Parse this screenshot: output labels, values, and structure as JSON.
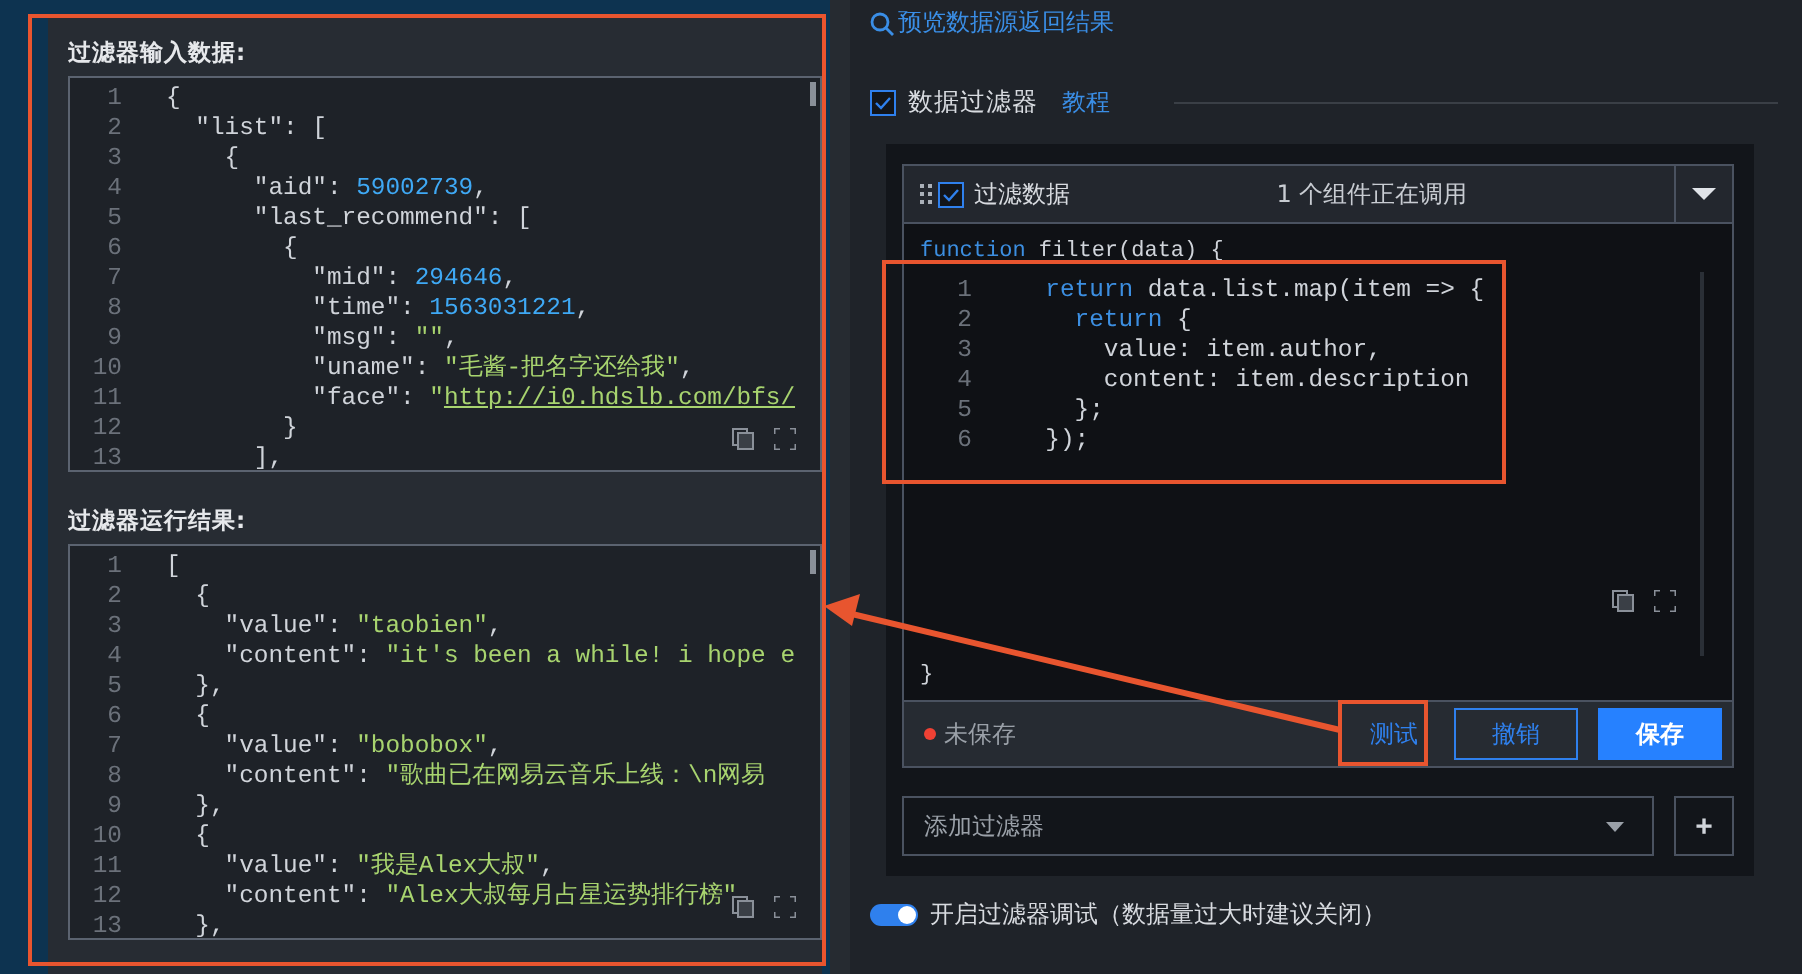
{
  "input_panel": {
    "title": "过滤器输入数据:",
    "lines": [
      {
        "n": "1",
        "segs": [
          {
            "t": "{",
            "kind": "plain"
          }
        ]
      },
      {
        "n": "2",
        "segs": [
          {
            "t": "  \"list\": [",
            "kind": "plain"
          }
        ]
      },
      {
        "n": "3",
        "segs": [
          {
            "t": "    {",
            "kind": "plain"
          }
        ]
      },
      {
        "n": "4",
        "segs": [
          {
            "t": "      \"aid\": ",
            "kind": "plain"
          },
          {
            "t": "59002739",
            "kind": "number"
          },
          {
            "t": ",",
            "kind": "plain"
          }
        ]
      },
      {
        "n": "5",
        "segs": [
          {
            "t": "      \"last_recommend\": [",
            "kind": "plain"
          }
        ]
      },
      {
        "n": "6",
        "segs": [
          {
            "t": "        {",
            "kind": "plain"
          }
        ]
      },
      {
        "n": "7",
        "segs": [
          {
            "t": "          \"mid\": ",
            "kind": "plain"
          },
          {
            "t": "294646",
            "kind": "number"
          },
          {
            "t": ",",
            "kind": "plain"
          }
        ]
      },
      {
        "n": "8",
        "segs": [
          {
            "t": "          \"time\": ",
            "kind": "plain"
          },
          {
            "t": "1563031221",
            "kind": "number"
          },
          {
            "t": ",",
            "kind": "plain"
          }
        ]
      },
      {
        "n": "9",
        "segs": [
          {
            "t": "          \"msg\": ",
            "kind": "plain"
          },
          {
            "t": "\"\"",
            "kind": "string"
          },
          {
            "t": ",",
            "kind": "plain"
          }
        ]
      },
      {
        "n": "10",
        "segs": [
          {
            "t": "          \"uname\": ",
            "kind": "plain"
          },
          {
            "t": "\"毛酱-把名字还给我\"",
            "kind": "string"
          },
          {
            "t": ",",
            "kind": "plain"
          }
        ]
      },
      {
        "n": "11",
        "segs": [
          {
            "t": "          \"face\": ",
            "kind": "plain"
          },
          {
            "t": "\"",
            "kind": "string"
          },
          {
            "t": "http://i0.hdslb.com/bfs/",
            "kind": "link"
          }
        ]
      },
      {
        "n": "12",
        "segs": [
          {
            "t": "        }",
            "kind": "plain"
          }
        ]
      },
      {
        "n": "13",
        "segs": [
          {
            "t": "      ],",
            "kind": "plain"
          }
        ]
      }
    ]
  },
  "output_panel": {
    "title": "过滤器运行结果:",
    "lines": [
      {
        "n": "1",
        "segs": [
          {
            "t": "[",
            "kind": "plain"
          }
        ]
      },
      {
        "n": "2",
        "segs": [
          {
            "t": "  {",
            "kind": "plain"
          }
        ]
      },
      {
        "n": "3",
        "segs": [
          {
            "t": "    \"value\": ",
            "kind": "plain"
          },
          {
            "t": "\"taobien\"",
            "kind": "string"
          },
          {
            "t": ",",
            "kind": "plain"
          }
        ]
      },
      {
        "n": "4",
        "segs": [
          {
            "t": "    \"content\": ",
            "kind": "plain"
          },
          {
            "t": "\"it's been a while! i hope e",
            "kind": "string"
          }
        ]
      },
      {
        "n": "5",
        "segs": [
          {
            "t": "  },",
            "kind": "plain"
          }
        ]
      },
      {
        "n": "6",
        "segs": [
          {
            "t": "  {",
            "kind": "plain"
          }
        ]
      },
      {
        "n": "7",
        "segs": [
          {
            "t": "    \"value\": ",
            "kind": "plain"
          },
          {
            "t": "\"bobobox\"",
            "kind": "string"
          },
          {
            "t": ",",
            "kind": "plain"
          }
        ]
      },
      {
        "n": "8",
        "segs": [
          {
            "t": "    \"content\": ",
            "kind": "plain"
          },
          {
            "t": "\"歌曲已在网易云音乐上线：\\n网易",
            "kind": "string"
          }
        ]
      },
      {
        "n": "9",
        "segs": [
          {
            "t": "  },",
            "kind": "plain"
          }
        ]
      },
      {
        "n": "10",
        "segs": [
          {
            "t": "  {",
            "kind": "plain"
          }
        ]
      },
      {
        "n": "11",
        "segs": [
          {
            "t": "    \"value\": ",
            "kind": "plain"
          },
          {
            "t": "\"我是Alex大叔\"",
            "kind": "string"
          },
          {
            "t": ",",
            "kind": "plain"
          }
        ]
      },
      {
        "n": "12",
        "segs": [
          {
            "t": "    \"content\": ",
            "kind": "plain"
          },
          {
            "t": "\"Alex大叔每月占星运势排行榜\"",
            "kind": "string"
          }
        ]
      },
      {
        "n": "13",
        "segs": [
          {
            "t": "  },",
            "kind": "plain"
          }
        ]
      }
    ]
  },
  "preview_link": "预览数据源返回结果",
  "data_filter": {
    "label": "数据过滤器",
    "checked": true,
    "tutorial_link": "教程"
  },
  "filter_card": {
    "checked": true,
    "name": "过滤数据",
    "usage": "1 个组件正在调用",
    "header_line": "function filter(data) {",
    "footer_line": "}",
    "lines": [
      {
        "n": "1",
        "segs": [
          {
            "t": "  return",
            "kind": "keyword"
          },
          {
            "t": " data.list.map(item => {",
            "kind": "plain"
          }
        ]
      },
      {
        "n": "2",
        "segs": [
          {
            "t": "    return",
            "kind": "keyword"
          },
          {
            "t": " {",
            "kind": "plain"
          }
        ]
      },
      {
        "n": "3",
        "segs": [
          {
            "t": "      value: item.author,",
            "kind": "plain"
          }
        ]
      },
      {
        "n": "4",
        "segs": [
          {
            "t": "      content: item.description",
            "kind": "plain"
          }
        ]
      },
      {
        "n": "5",
        "segs": [
          {
            "t": "    };",
            "kind": "plain"
          }
        ]
      },
      {
        "n": "6",
        "segs": [
          {
            "t": "  });",
            "kind": "plain"
          }
        ]
      }
    ],
    "status": "未保存",
    "saved": false,
    "buttons": [
      {
        "label": "测试",
        "kind": "text"
      },
      {
        "label": "撤销",
        "kind": "outline"
      },
      {
        "label": "保存",
        "kind": "primary"
      }
    ]
  },
  "add_filter": {
    "placeholder": "添加过滤器",
    "add": "+"
  },
  "debug_toggle": {
    "label": "开启过滤器调试（数据量过大时建议关闭）",
    "on": true
  }
}
